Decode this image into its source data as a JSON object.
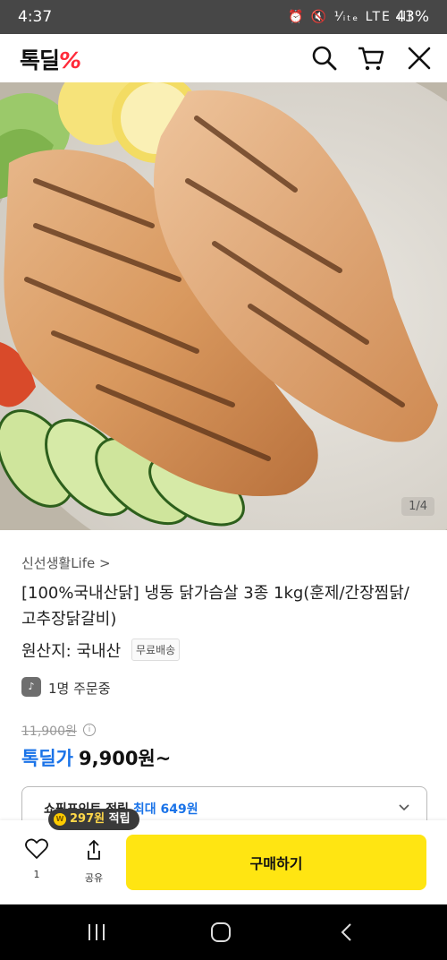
{
  "status_bar": {
    "time": "4:37",
    "icons": "⏰ 🔇 ⅟ᵢₜₑ LTE ıll",
    "battery": "43%"
  },
  "header": {
    "logo_text": "톡딜",
    "logo_mark": "%",
    "brand_color": "#ff2b3a",
    "icons": [
      "search-icon",
      "cart-icon",
      "close-icon"
    ]
  },
  "hero": {
    "page_indicator": "1/4"
  },
  "product": {
    "seller": "신선생활Life >",
    "title": "[100%국내산닭] 냉동 닭가슴살 3종 1kg(훈제/간장찜닭/고추장닭갈비)",
    "origin": "원산지: 국내산",
    "badge": "무료배송",
    "orders": "1명 주문중",
    "original_price": "11,900원",
    "sale_label": "톡딜가",
    "sale_price": "9,900원~",
    "points_label": "쇼핑포인트 적립",
    "points_max": "최대 649원"
  },
  "bottom": {
    "like_count": "1",
    "share_label": "공유",
    "buy_label": "구매하기",
    "tooltip_amount": "297원",
    "tooltip_suffix": " 적립"
  },
  "colors": {
    "accent_blue": "#1a73e8",
    "buy_yellow": "#ffe512",
    "tooltip_bg": "#3a3a3a"
  }
}
